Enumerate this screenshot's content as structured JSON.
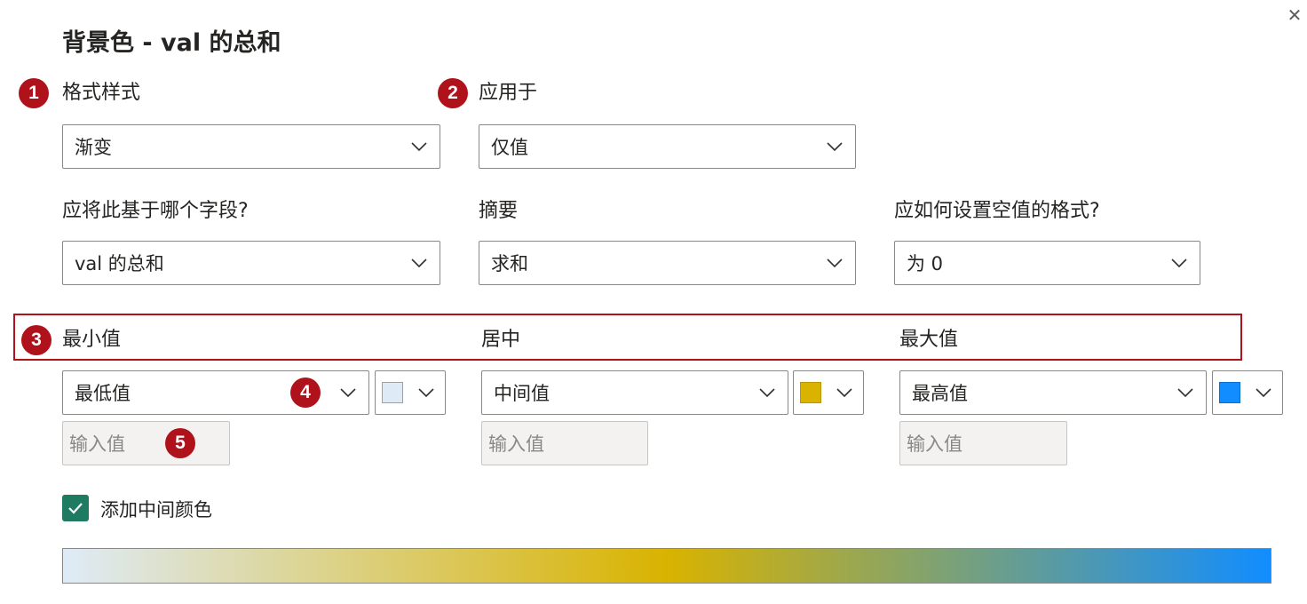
{
  "dialog": {
    "title": "背景色 - val 的总和",
    "close_glyph": "✕"
  },
  "badges": [
    "1",
    "2",
    "3",
    "4",
    "5"
  ],
  "format_style": {
    "label": "格式样式",
    "value": "渐变"
  },
  "apply_to": {
    "label": "应用于",
    "value": "仅值"
  },
  "based_on_field": {
    "label": "应将此基于哪个字段?",
    "value": "val 的总和"
  },
  "summarization": {
    "label": "摘要",
    "value": "求和"
  },
  "empty_values": {
    "label": "应如何设置空值的格式?",
    "value": "为 0"
  },
  "gradient_stops": {
    "minimum": {
      "label": "最小值",
      "type_value": "最低值",
      "input_placeholder": "输入值",
      "color": "#deebf7"
    },
    "center": {
      "label": "居中",
      "type_value": "中间值",
      "input_placeholder": "输入值",
      "color": "#d9b300"
    },
    "maximum": {
      "label": "最大值",
      "type_value": "最高值",
      "input_placeholder": "输入值",
      "color": "#118dff"
    }
  },
  "add_middle_color": {
    "label": "添加中间颜色",
    "checked": true
  },
  "colors": {
    "badge": "#b0121b",
    "checkbox": "#1e7a61",
    "gradient": [
      "#deebf7",
      "#d9b300",
      "#118dff"
    ]
  },
  "icons": {
    "close": "close-icon",
    "dropdown": "chevron-down-icon",
    "check": "checkmark-icon"
  }
}
